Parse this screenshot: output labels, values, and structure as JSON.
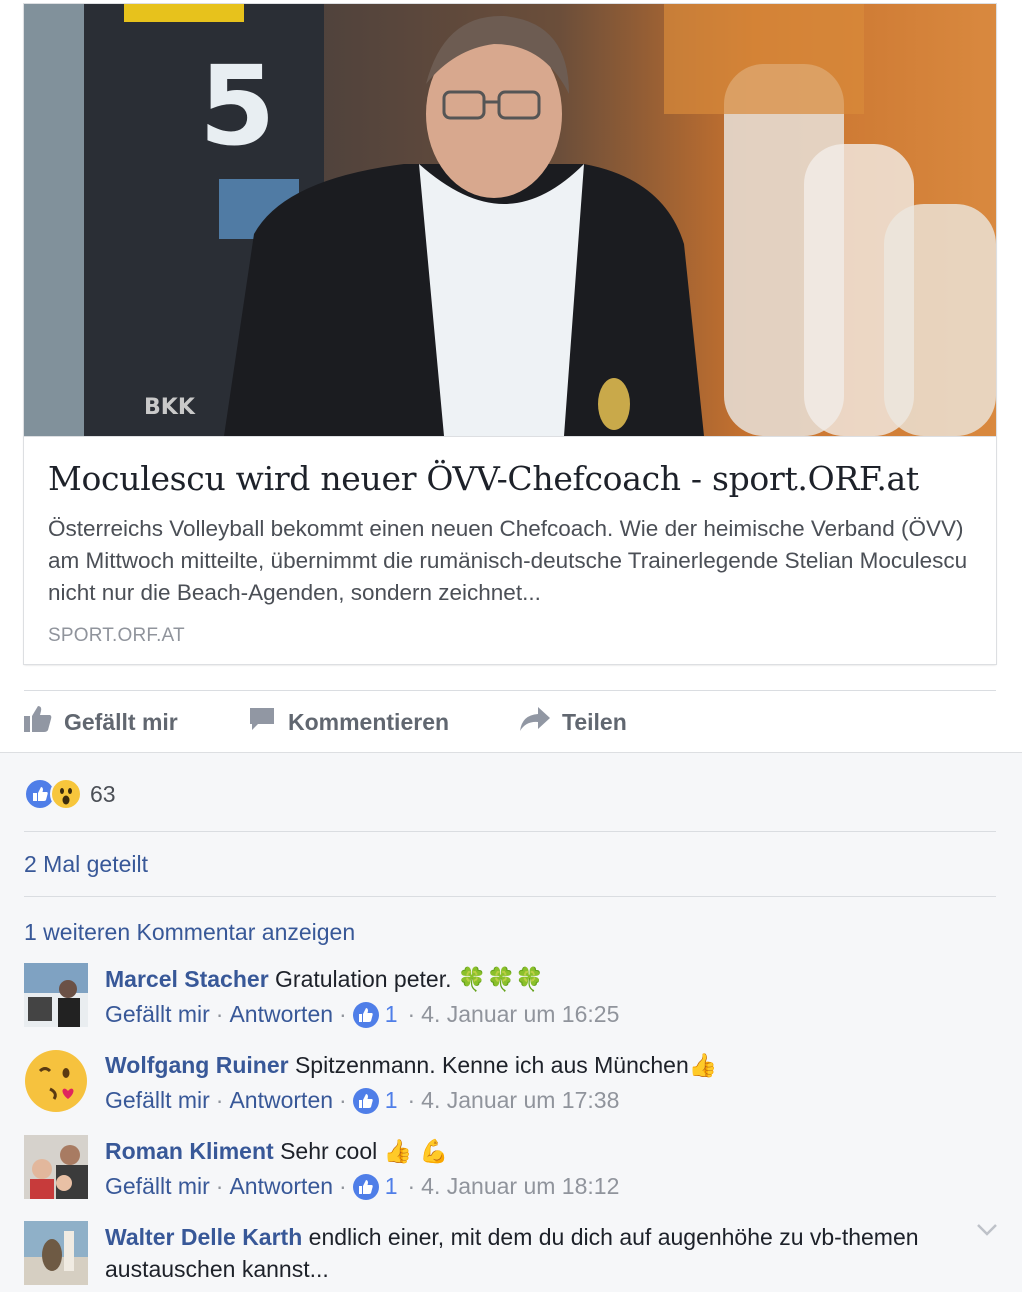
{
  "post": {
    "title": "Moculescu wird neuer ÖVV-Chefcoach - sport.ORF.at",
    "description": "Österreichs Volleyball bekommt einen neuen Chefcoach. Wie der heimische Verband (ÖVV) am Mittwoch mitteilte, übernimmt die rumänisch-deutsche Trainerlegende Stelian Moculescu nicht nur die Beach-Agenden, sondern zeichnet...",
    "domain": "SPORT.ORF.AT",
    "image_jersey_number": "5",
    "image_sponsor_text": "BKK"
  },
  "actions": {
    "like": "Gefällt mir",
    "comment": "Kommentieren",
    "share": "Teilen"
  },
  "reactions": {
    "count": "63",
    "types": [
      "like-icon",
      "wow-icon"
    ]
  },
  "shares": "2 Mal geteilt",
  "more_comments": "1 weiteren Kommentar anzeigen",
  "comments": [
    {
      "name": "Marcel Stacher",
      "text": "Gratulation peter. ",
      "emoji": "🍀🍀🍀",
      "like": "Gefällt mir",
      "reply": "Antworten",
      "likes": "1",
      "time": "4. Januar um 16:25"
    },
    {
      "name": "Wolfgang Ruiner",
      "text": "Spitzenmann. Kenne ich aus München",
      "emoji": "👍",
      "like": "Gefällt mir",
      "reply": "Antworten",
      "likes": "1",
      "time": "4. Januar um 17:38"
    },
    {
      "name": "Roman Kliment",
      "text": "Sehr cool ",
      "emoji": "👍 💪",
      "like": "Gefällt mir",
      "reply": "Antworten",
      "likes": "1",
      "time": "4. Januar um 18:12"
    },
    {
      "name": "Walter Delle Karth",
      "text": "endlich einer, mit dem du dich auf augenhöhe zu vb-themen austauschen kannst..."
    }
  ],
  "colors": {
    "link": "#385898",
    "like_blue": "#4f7ee8",
    "meta_grey": "#90949c",
    "grey_bg": "#f6f7f9"
  }
}
